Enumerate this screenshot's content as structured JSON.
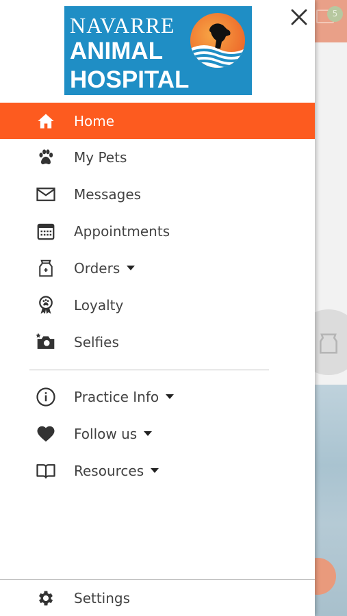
{
  "logo": {
    "line1": "NAVARRE",
    "line2": "ANIMAL",
    "line3": "HOSPITAL"
  },
  "background": {
    "mail_badge": "5"
  },
  "menu": [
    {
      "label": "Home",
      "icon": "home-icon",
      "active": true
    },
    {
      "label": "My Pets",
      "icon": "paw-icon"
    },
    {
      "label": "Messages",
      "icon": "mail-icon"
    },
    {
      "label": "Appointments",
      "icon": "calendar-icon"
    },
    {
      "label": "Orders",
      "icon": "pet-food-bag-icon",
      "has_dropdown": true
    },
    {
      "label": "Loyalty",
      "icon": "paw-ribbon-icon"
    },
    {
      "label": "Selfies",
      "icon": "camera-icon"
    }
  ],
  "menu_secondary": [
    {
      "label": "Practice Info",
      "icon": "info-icon",
      "has_dropdown": true
    },
    {
      "label": "Follow us",
      "icon": "heart-icon",
      "has_dropdown": true
    },
    {
      "label": "Resources",
      "icon": "book-icon",
      "has_dropdown": true
    }
  ],
  "settings": {
    "label": "Settings",
    "icon": "gear-icon"
  },
  "colors": {
    "accent": "#fd5b1f",
    "logo_bg": "#1f8ec5",
    "text": "#424242"
  }
}
